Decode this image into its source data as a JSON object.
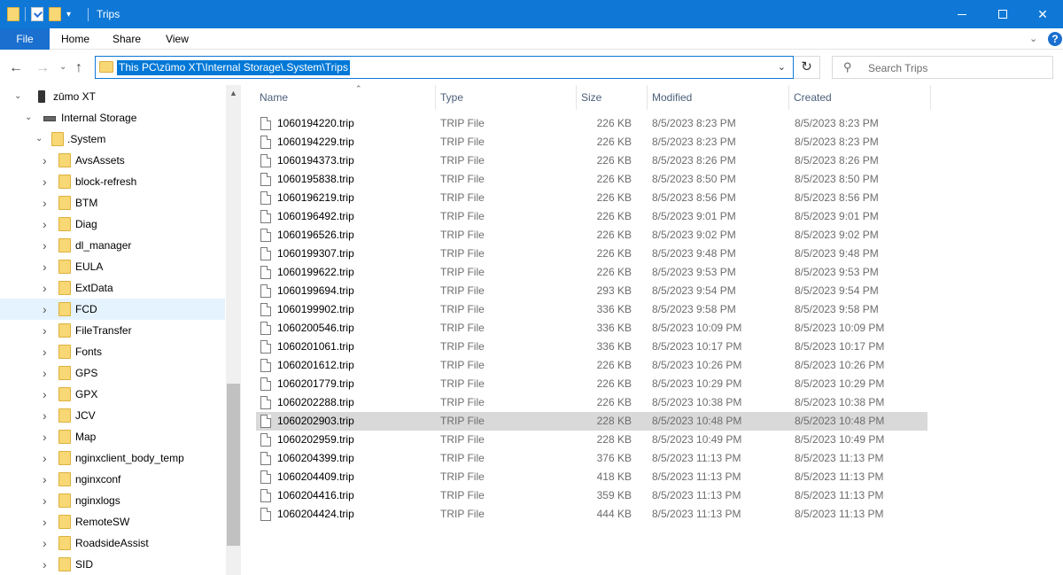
{
  "window": {
    "title": "Trips",
    "controls": {
      "minimize": "—",
      "maximize": "□",
      "close": "✕"
    }
  },
  "ribbon": {
    "tabs": [
      {
        "label": "File"
      },
      {
        "label": "Home"
      },
      {
        "label": "Share"
      },
      {
        "label": "View"
      }
    ],
    "help": "?"
  },
  "nav": {
    "address_path": "This PC\\zūmo XT\\Internal Storage\\.System\\Trips",
    "search_placeholder": "Search Trips"
  },
  "tree": {
    "items": [
      {
        "label": "zūmo XT",
        "level": 1,
        "expanded": true,
        "icon": "device-icon"
      },
      {
        "label": "Internal Storage",
        "level": 2,
        "expanded": true,
        "icon": "drive-icon"
      },
      {
        "label": ".System",
        "level": 3,
        "expanded": true,
        "icon": "folder-icon"
      },
      {
        "label": "AvsAssets",
        "level": 4,
        "icon": "folder-icon"
      },
      {
        "label": "block-refresh",
        "level": 4,
        "icon": "folder-icon"
      },
      {
        "label": "BTM",
        "level": 4,
        "icon": "folder-icon"
      },
      {
        "label": "Diag",
        "level": 4,
        "icon": "folder-icon"
      },
      {
        "label": "dl_manager",
        "level": 4,
        "icon": "folder-icon"
      },
      {
        "label": "EULA",
        "level": 4,
        "icon": "folder-icon"
      },
      {
        "label": "ExtData",
        "level": 4,
        "icon": "folder-icon"
      },
      {
        "label": "FCD",
        "level": 4,
        "icon": "folder-icon",
        "selected": true
      },
      {
        "label": "FileTransfer",
        "level": 4,
        "icon": "folder-icon"
      },
      {
        "label": "Fonts",
        "level": 4,
        "icon": "folder-icon"
      },
      {
        "label": "GPS",
        "level": 4,
        "icon": "folder-icon"
      },
      {
        "label": "GPX",
        "level": 4,
        "icon": "folder-icon"
      },
      {
        "label": "JCV",
        "level": 4,
        "icon": "folder-icon"
      },
      {
        "label": "Map",
        "level": 4,
        "icon": "folder-icon"
      },
      {
        "label": "nginxclient_body_temp",
        "level": 4,
        "icon": "folder-icon"
      },
      {
        "label": "nginxconf",
        "level": 4,
        "icon": "folder-icon"
      },
      {
        "label": "nginxlogs",
        "level": 4,
        "icon": "folder-icon"
      },
      {
        "label": "RemoteSW",
        "level": 4,
        "icon": "folder-icon"
      },
      {
        "label": "RoadsideAssist",
        "level": 4,
        "icon": "folder-icon"
      },
      {
        "label": "SID",
        "level": 4,
        "icon": "folder-icon"
      }
    ]
  },
  "files": {
    "columns": [
      "Name",
      "Type",
      "Size",
      "Modified",
      "Created"
    ],
    "rows": [
      {
        "name": "1060194220.trip",
        "type": "TRIP File",
        "size": "226 KB",
        "modified": "8/5/2023 8:23 PM",
        "created": "8/5/2023 8:23 PM"
      },
      {
        "name": "1060194229.trip",
        "type": "TRIP File",
        "size": "226 KB",
        "modified": "8/5/2023 8:23 PM",
        "created": "8/5/2023 8:23 PM"
      },
      {
        "name": "1060194373.trip",
        "type": "TRIP File",
        "size": "226 KB",
        "modified": "8/5/2023 8:26 PM",
        "created": "8/5/2023 8:26 PM"
      },
      {
        "name": "1060195838.trip",
        "type": "TRIP File",
        "size": "226 KB",
        "modified": "8/5/2023 8:50 PM",
        "created": "8/5/2023 8:50 PM"
      },
      {
        "name": "1060196219.trip",
        "type": "TRIP File",
        "size": "226 KB",
        "modified": "8/5/2023 8:56 PM",
        "created": "8/5/2023 8:56 PM"
      },
      {
        "name": "1060196492.trip",
        "type": "TRIP File",
        "size": "226 KB",
        "modified": "8/5/2023 9:01 PM",
        "created": "8/5/2023 9:01 PM"
      },
      {
        "name": "1060196526.trip",
        "type": "TRIP File",
        "size": "226 KB",
        "modified": "8/5/2023 9:02 PM",
        "created": "8/5/2023 9:02 PM"
      },
      {
        "name": "1060199307.trip",
        "type": "TRIP File",
        "size": "226 KB",
        "modified": "8/5/2023 9:48 PM",
        "created": "8/5/2023 9:48 PM"
      },
      {
        "name": "1060199622.trip",
        "type": "TRIP File",
        "size": "226 KB",
        "modified": "8/5/2023 9:53 PM",
        "created": "8/5/2023 9:53 PM"
      },
      {
        "name": "1060199694.trip",
        "type": "TRIP File",
        "size": "293 KB",
        "modified": "8/5/2023 9:54 PM",
        "created": "8/5/2023 9:54 PM"
      },
      {
        "name": "1060199902.trip",
        "type": "TRIP File",
        "size": "336 KB",
        "modified": "8/5/2023 9:58 PM",
        "created": "8/5/2023 9:58 PM"
      },
      {
        "name": "1060200546.trip",
        "type": "TRIP File",
        "size": "336 KB",
        "modified": "8/5/2023 10:09 PM",
        "created": "8/5/2023 10:09 PM"
      },
      {
        "name": "1060201061.trip",
        "type": "TRIP File",
        "size": "336 KB",
        "modified": "8/5/2023 10:17 PM",
        "created": "8/5/2023 10:17 PM"
      },
      {
        "name": "1060201612.trip",
        "type": "TRIP File",
        "size": "226 KB",
        "modified": "8/5/2023 10:26 PM",
        "created": "8/5/2023 10:26 PM"
      },
      {
        "name": "1060201779.trip",
        "type": "TRIP File",
        "size": "226 KB",
        "modified": "8/5/2023 10:29 PM",
        "created": "8/5/2023 10:29 PM"
      },
      {
        "name": "1060202288.trip",
        "type": "TRIP File",
        "size": "226 KB",
        "modified": "8/5/2023 10:38 PM",
        "created": "8/5/2023 10:38 PM"
      },
      {
        "name": "1060202903.trip",
        "type": "TRIP File",
        "size": "228 KB",
        "modified": "8/5/2023 10:48 PM",
        "created": "8/5/2023 10:48 PM",
        "selected": true
      },
      {
        "name": "1060202959.trip",
        "type": "TRIP File",
        "size": "228 KB",
        "modified": "8/5/2023 10:49 PM",
        "created": "8/5/2023 10:49 PM"
      },
      {
        "name": "1060204399.trip",
        "type": "TRIP File",
        "size": "376 KB",
        "modified": "8/5/2023 11:13 PM",
        "created": "8/5/2023 11:13 PM"
      },
      {
        "name": "1060204409.trip",
        "type": "TRIP File",
        "size": "418 KB",
        "modified": "8/5/2023 11:13 PM",
        "created": "8/5/2023 11:13 PM"
      },
      {
        "name": "1060204416.trip",
        "type": "TRIP File",
        "size": "359 KB",
        "modified": "8/5/2023 11:13 PM",
        "created": "8/5/2023 11:13 PM"
      },
      {
        "name": "1060204424.trip",
        "type": "TRIP File",
        "size": "444 KB",
        "modified": "8/5/2023 11:13 PM",
        "created": "8/5/2023 11:13 PM"
      }
    ]
  },
  "colors": {
    "titlebar": "#0f78d7",
    "file_tab": "#1a6fcf",
    "address_highlight": "#0078d7",
    "tree_selected": "#e5f3ff",
    "row_selected": "#d9d9d9",
    "folder": "#f8d775"
  }
}
